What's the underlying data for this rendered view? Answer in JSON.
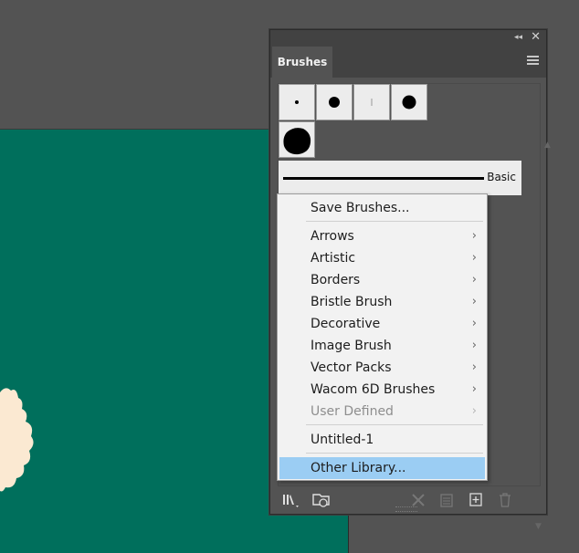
{
  "panel": {
    "tab_label": "Brushes",
    "collapse_glyph": "◂◂",
    "close_glyph": "✕",
    "basic_label": "Basic"
  },
  "menu": {
    "save": "Save Brushes...",
    "libraries": [
      {
        "label": "Arrows",
        "disabled": false
      },
      {
        "label": "Artistic",
        "disabled": false
      },
      {
        "label": "Borders",
        "disabled": false
      },
      {
        "label": "Bristle Brush",
        "disabled": false
      },
      {
        "label": "Decorative",
        "disabled": false
      },
      {
        "label": "Image Brush",
        "disabled": false
      },
      {
        "label": "Vector Packs",
        "disabled": false
      },
      {
        "label": "Wacom 6D Brushes",
        "disabled": false
      },
      {
        "label": "User Defined",
        "disabled": true
      }
    ],
    "untitled": "Untitled-1",
    "other": "Other Library...",
    "chevron": "›"
  },
  "icons": {
    "library": "brush-libraries-menu-icon",
    "cloud_libraries": "libraries-panel-icon",
    "remove_stroke": "remove-brush-stroke-icon",
    "options": "options-of-selected-object-icon",
    "new_brush": "new-brush-icon",
    "delete_brush": "delete-brush-icon"
  },
  "colors": {
    "artboard": "#006f5c",
    "menu_highlight": "#9bcdf3",
    "cream_shape": "#fbe9d2"
  }
}
